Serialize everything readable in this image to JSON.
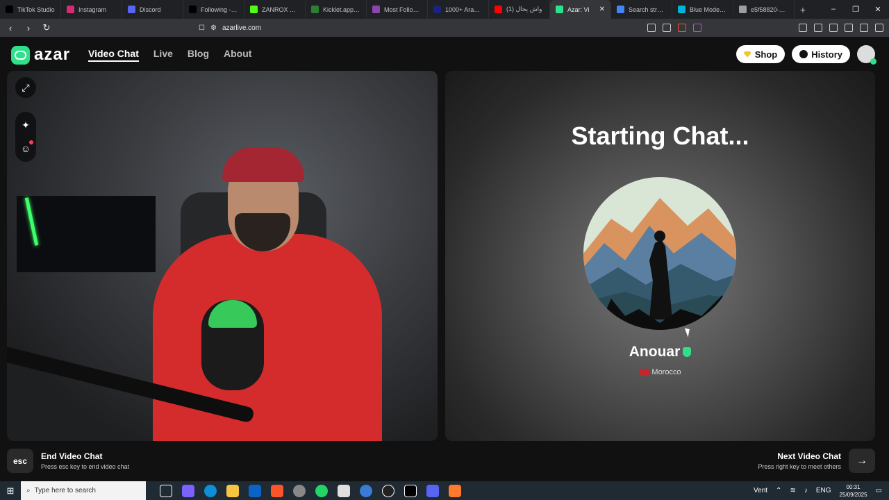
{
  "browser": {
    "tabs": [
      {
        "title": "TikTok Studio",
        "color": "#000000"
      },
      {
        "title": "Instagram",
        "color": "#d62976"
      },
      {
        "title": "Discord",
        "color": "#5865f2"
      },
      {
        "title": "Following - We",
        "color": "#000000"
      },
      {
        "title": "ZANROX Strea",
        "color": "#53fc18"
      },
      {
        "title": "Kicklet.app - K",
        "color": "#2e7d32"
      },
      {
        "title": "Most Followed",
        "color": "#8e44ad"
      },
      {
        "title": "1000+ Arabic N",
        "color": "#1a237e"
      },
      {
        "title": "واش يحال (1)",
        "color": "#ff0000"
      },
      {
        "title": "Azar: Vi",
        "color": "#2fe08a"
      },
      {
        "title": "Search straem",
        "color": "#4285f4"
      },
      {
        "title": "Blue Modern S",
        "color": "#00b4d8"
      },
      {
        "title": "e5f58820-9dfc",
        "color": "#9e9e9e"
      }
    ],
    "active_tab_index": 9,
    "new_tab": "+",
    "url": "azarlive.com"
  },
  "site": {
    "logo_text": "azar",
    "nav": [
      {
        "label": "Video Chat",
        "active": true
      },
      {
        "label": "Live",
        "active": false
      },
      {
        "label": "Blog",
        "active": false
      },
      {
        "label": "About",
        "active": false
      }
    ],
    "shop_label": "Shop",
    "history_label": "History"
  },
  "chat": {
    "status_title": "Starting Chat...",
    "partner_name": "Anouar",
    "partner_country": "Morocco"
  },
  "footer": {
    "esc_key": "esc",
    "end_title": "End Video Chat",
    "end_sub": "Press esc key to end video chat",
    "next_title": "Next Video Chat",
    "next_sub": "Press right key to meet others"
  },
  "taskbar": {
    "search_placeholder": "Type here to search",
    "weather": "Vent",
    "lang": "ENG",
    "time": "00:31",
    "date": "25/09/2025"
  }
}
